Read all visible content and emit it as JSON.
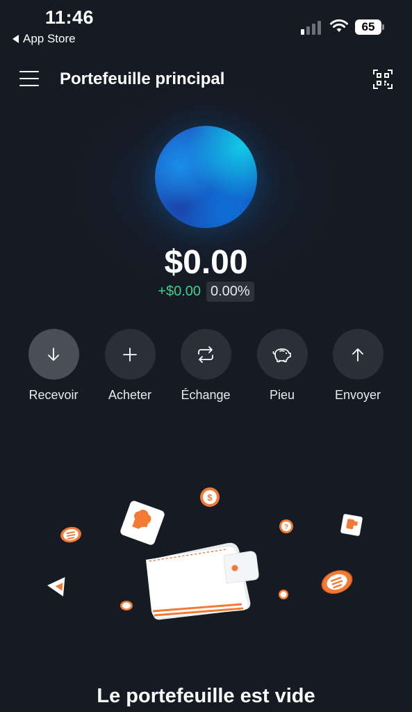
{
  "status_bar": {
    "time": "11:46",
    "back_label": "App Store",
    "battery": "65"
  },
  "header": {
    "title": "Portefeuille principal",
    "menu_icon": "hamburger-menu-icon",
    "scan_icon": "qr-scan-icon"
  },
  "balance": {
    "amount": "$0.00",
    "change_amount": "+$0.00",
    "change_percent": "0.00%"
  },
  "actions": [
    {
      "label": "Recevoir",
      "icon": "arrow-down-icon"
    },
    {
      "label": "Acheter",
      "icon": "plus-icon"
    },
    {
      "label": "Échange",
      "icon": "swap-icon"
    },
    {
      "label": "Pieu",
      "icon": "piggy-bank-icon"
    },
    {
      "label": "Envoyer",
      "icon": "arrow-up-icon"
    }
  ],
  "empty_state": {
    "message": "Le portefeuille est vide"
  },
  "colors": {
    "background": "#161a23",
    "positive": "#3ecf8e",
    "accent": "#f27a35",
    "button": "#2a2f38"
  }
}
